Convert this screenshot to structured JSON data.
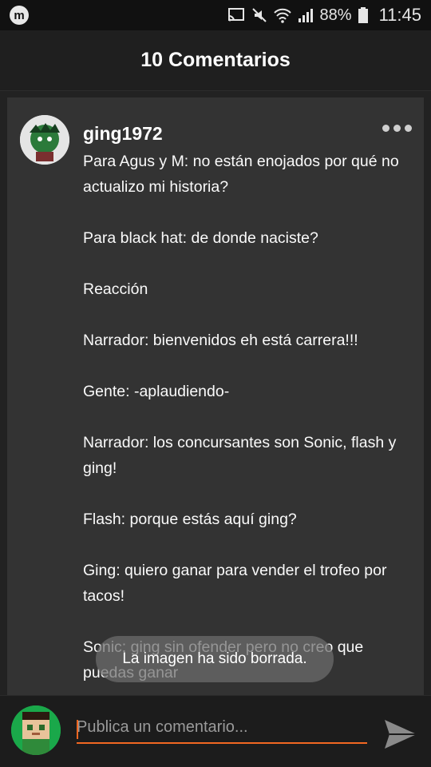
{
  "status_bar": {
    "app_icon": "m",
    "battery": "88%",
    "time": "11:45"
  },
  "header": {
    "title": "10 Comentarios"
  },
  "comment": {
    "username": "ging1972",
    "lines": [
      "Para Agus y M: no están enojados por qué no actualizo mi historia?",
      "Para black hat: de donde naciste?",
      "Reacción",
      "Narrador: bienvenidos eh está carrera!!!",
      "Gente: -aplaudiendo-",
      "Narrador: los concursantes son Sonic, flash y ging!",
      "Flash: porque estás aquí ging?",
      "Ging: quiero ganar para vender el trofeo por tacos!",
      "Sonic: ging sin ofender pero no creo que puedas ganar"
    ]
  },
  "toast": {
    "text": "La imagen ha sido borrada."
  },
  "composer": {
    "placeholder": "Publica un comentario..."
  },
  "colors": {
    "accent": "#f26722",
    "card": "#333333",
    "background": "#1e1e1e"
  }
}
